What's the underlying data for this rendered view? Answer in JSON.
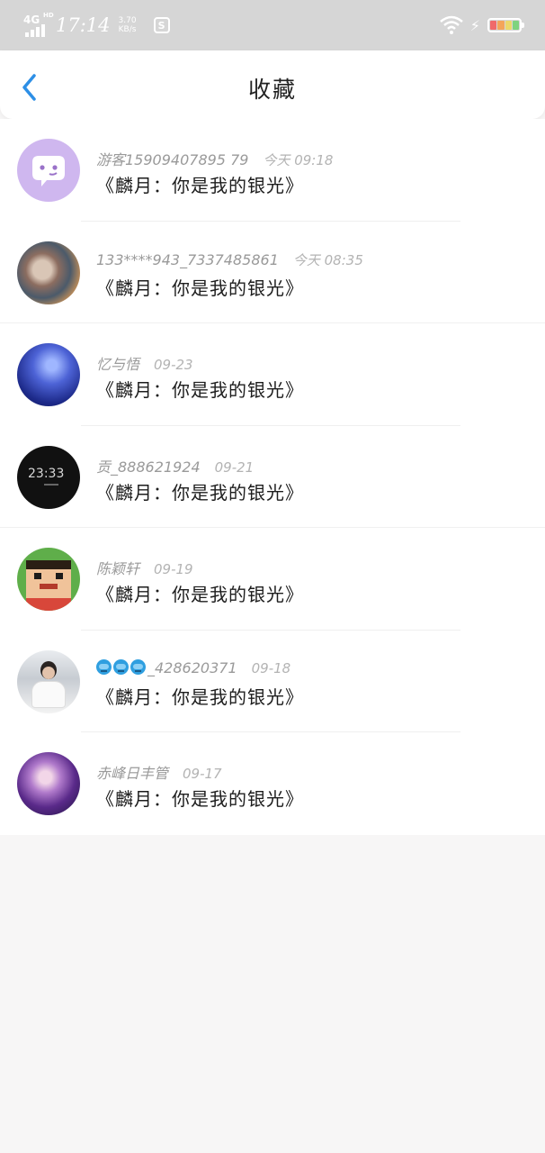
{
  "status_bar": {
    "network": "4G",
    "network_sup": "HD",
    "time": "17:14",
    "speed_value": "3.70",
    "speed_unit": "KB/s",
    "app_icon_letter": "S"
  },
  "header": {
    "back_icon": "chevron-left-icon",
    "title": "收藏"
  },
  "favorites": [
    {
      "user": "游客15909407895 79",
      "time": "今天 09:18",
      "title": "《麟月：你是我的银光》"
    },
    {
      "user": "133****943_7337485861",
      "time": "今天 08:35",
      "title": "《麟月：你是我的银光》"
    },
    {
      "user": "忆与悟",
      "time": "09-23",
      "title": "《麟月：你是我的银光》"
    },
    {
      "user": "贡_888621924",
      "time": "09-21",
      "title": "《麟月：你是我的银光》"
    },
    {
      "user": "陈颖轩",
      "time": "09-19",
      "title": "《麟月：你是我的银光》"
    },
    {
      "user": "_428620371",
      "time": "09-18",
      "title": "《麟月：你是我的银光》"
    },
    {
      "user": "赤峰日丰管",
      "time": "09-17",
      "title": "《麟月：你是我的银光》"
    }
  ],
  "colors": {
    "accent_blue": "#2d8fe6",
    "status_bar_bg": "#d6d6d6",
    "page_bg": "#f7f6f6"
  }
}
